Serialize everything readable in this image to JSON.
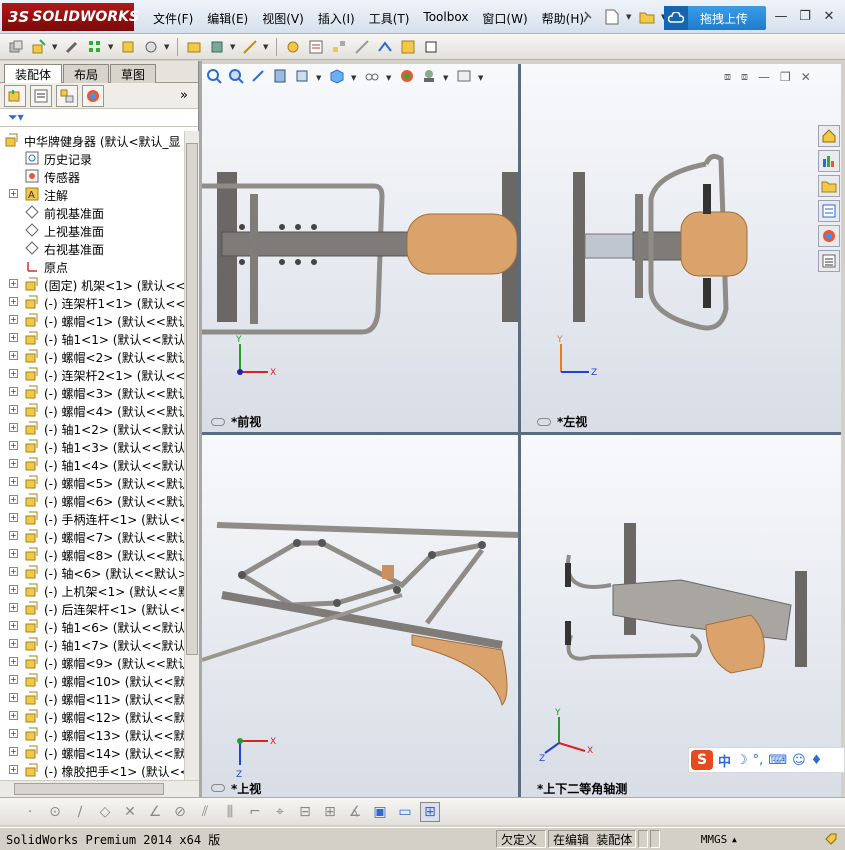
{
  "app": {
    "brand": "SOLIDWORKS",
    "brand_prefix": "3S"
  },
  "menu": [
    "文件(F)",
    "编辑(E)",
    "视图(V)",
    "插入(I)",
    "工具(T)",
    "Toolbox",
    "窗口(W)",
    "帮助(H)"
  ],
  "upload_button": "拖拽上传",
  "tabs": [
    {
      "label": "装配体",
      "active": true
    },
    {
      "label": "布局",
      "active": false
    },
    {
      "label": "草图",
      "active": false
    }
  ],
  "tree": {
    "root": "中华牌健身器  (默认<默认_显",
    "items": [
      {
        "label": "历史记录",
        "icon": "history-icon",
        "expand": false
      },
      {
        "label": "传感器",
        "icon": "sensor-icon",
        "expand": false
      },
      {
        "label": "注解",
        "icon": "annotation-icon",
        "expand": true
      },
      {
        "label": "前视基准面",
        "icon": "plane-icon",
        "expand": false
      },
      {
        "label": "上视基准面",
        "icon": "plane-icon",
        "expand": false
      },
      {
        "label": "右视基准面",
        "icon": "plane-icon",
        "expand": false
      },
      {
        "label": "原点",
        "icon": "origin-icon",
        "expand": false
      },
      {
        "label": "(固定) 机架<1> (默认<<默",
        "icon": "part-icon",
        "expand": true
      },
      {
        "label": "(-) 连架杆1<1> (默认<<默",
        "icon": "part-icon",
        "expand": true
      },
      {
        "label": "(-) 螺帽<1> (默认<<默认",
        "icon": "part-icon",
        "expand": true
      },
      {
        "label": "(-) 轴1<1> (默认<<默认>",
        "icon": "part-icon",
        "expand": true
      },
      {
        "label": "(-) 螺帽<2> (默认<<默认",
        "icon": "part-icon",
        "expand": true
      },
      {
        "label": "(-) 连架杆2<1> (默认<<默",
        "icon": "part-icon",
        "expand": true
      },
      {
        "label": "(-) 螺帽<3> (默认<<默认",
        "icon": "part-icon",
        "expand": true
      },
      {
        "label": "(-) 螺帽<4> (默认<<默认",
        "icon": "part-icon",
        "expand": true
      },
      {
        "label": "(-) 轴1<2> (默认<<默认>",
        "icon": "part-icon",
        "expand": true
      },
      {
        "label": "(-) 轴1<3> (默认<<默认>",
        "icon": "part-icon",
        "expand": true
      },
      {
        "label": "(-) 轴1<4> (默认<<默认>",
        "icon": "part-icon",
        "expand": true
      },
      {
        "label": "(-) 螺帽<5> (默认<<默认",
        "icon": "part-icon",
        "expand": true
      },
      {
        "label": "(-) 螺帽<6> (默认<<默认",
        "icon": "part-icon",
        "expand": true
      },
      {
        "label": "(-) 手柄连杆<1> (默认<<",
        "icon": "part-icon",
        "expand": true
      },
      {
        "label": "(-) 螺帽<7> (默认<<默认",
        "icon": "part-icon",
        "expand": true
      },
      {
        "label": "(-) 螺帽<8> (默认<<默认",
        "icon": "part-icon",
        "expand": true
      },
      {
        "label": "(-) 轴<6> (默认<<默认>_",
        "icon": "part-icon",
        "expand": true
      },
      {
        "label": "(-) 上机架<1> (默认<<默",
        "icon": "part-icon",
        "expand": true
      },
      {
        "label": "(-) 后连架杆<1> (默认<<",
        "icon": "part-icon",
        "expand": true
      },
      {
        "label": "(-) 轴1<6> (默认<<默认>",
        "icon": "part-icon",
        "expand": true
      },
      {
        "label": "(-) 轴1<7> (默认<<默认>",
        "icon": "part-icon",
        "expand": true
      },
      {
        "label": "(-) 螺帽<9> (默认<<默认",
        "icon": "part-icon",
        "expand": true
      },
      {
        "label": "(-) 螺帽<10> (默认<<默认",
        "icon": "part-icon",
        "expand": true
      },
      {
        "label": "(-) 螺帽<11> (默认<<默认",
        "icon": "part-icon",
        "expand": true
      },
      {
        "label": "(-) 螺帽<12> (默认<<默认",
        "icon": "part-icon",
        "expand": true
      },
      {
        "label": "(-) 螺帽<13> (默认<<默认",
        "icon": "part-icon",
        "expand": true
      },
      {
        "label": "(-) 螺帽<14> (默认<<默认",
        "icon": "part-icon",
        "expand": true
      },
      {
        "label": "(-) 橡胶把手<1> (默认<<",
        "icon": "part-icon",
        "expand": true
      }
    ]
  },
  "viewports": {
    "front": "*前视",
    "left": "*左视",
    "top": "*上视",
    "iso": "*上下二等角轴测"
  },
  "axes": {
    "x": "X",
    "y": "Y",
    "z": "Z"
  },
  "status": {
    "app": "SolidWorks Premium 2014 x64 版",
    "defined": "欠定义",
    "editing": "在编辑 装配体",
    "units": "MMGS"
  },
  "ime": {
    "label": "中"
  },
  "colors": {
    "accent": "#1f7ccc",
    "part_tan": "#d9a36b",
    "metal": "#8f8c88"
  }
}
